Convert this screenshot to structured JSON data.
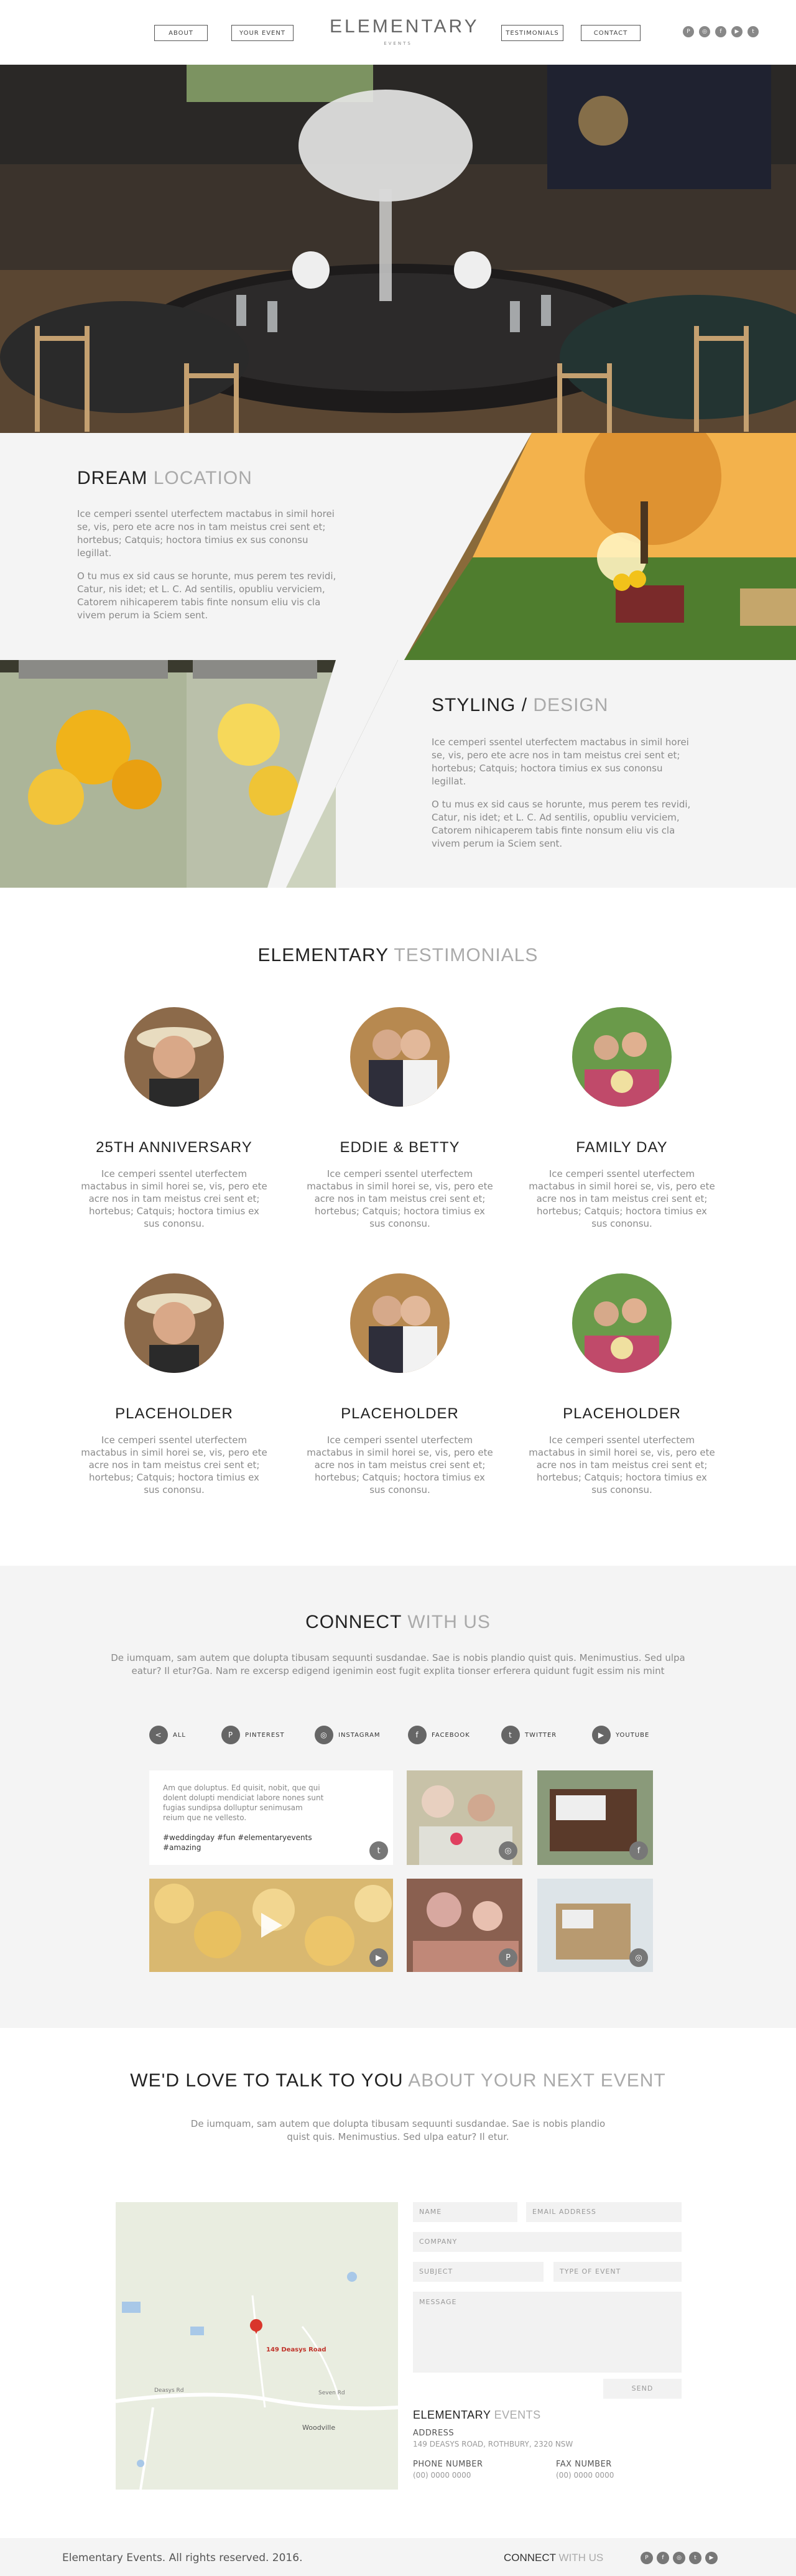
{
  "nav": {
    "about": "ABOUT",
    "your_event": "YOUR EVENT",
    "testimonials": "TESTIMONIALS",
    "contact": "CONTACT",
    "logo": "ELEMENTARY",
    "logo_sub": "EVENTS"
  },
  "dream": {
    "title_dark": "DREAM",
    "title_light": "LOCATION",
    "p1": "Ice cemperi ssentel uterfectem mactabus in simil horei se, vis, pero ete acre nos in tam meistus crei sent et; hortebus; Catquis; hoctora timius ex sus cononsu legillat.",
    "p2": "O tu mus ex sid caus se horunte, mus perem tes revidi, Catur, nis idet; et L. C. Ad sentilis, opubliu verviciem, Catorem nihicaperem tabis finte nonsum eliu vis cla vivem perum ia Sciem sent."
  },
  "styling": {
    "title_dark": "STYLING /",
    "title_light": "DESIGN",
    "p1": "Ice cemperi ssentel uterfectem mactabus in simil horei se, vis, pero ete acre nos in tam meistus crei sent et; hortebus; Catquis; hoctora timius ex sus cononsu legillat.",
    "p2": "O tu mus ex sid caus se horunte, mus perem tes revidi, Catur, nis idet; et L. C. Ad sentilis, opubliu verviciem, Catorem nihicaperem tabis finte nonsum eliu vis cla vivem perum ia Sciem sent."
  },
  "testimonials": {
    "title_dark": "ELEMENTARY",
    "title_light": "TESTIMONIALS",
    "items": [
      {
        "name": "25TH ANNIVERSARY",
        "text": "Ice cemperi ssentel uterfectem mactabus in simil horei se, vis, pero ete acre nos in tam meistus crei sent et; hortebus; Catquis; hoctora timius ex sus cononsu."
      },
      {
        "name": "EDDIE & BETTY",
        "text": "Ice cemperi ssentel uterfectem mactabus in simil horei se, vis, pero ete acre nos in tam meistus crei sent et; hortebus; Catquis; hoctora timius ex sus cononsu."
      },
      {
        "name": "FAMILY DAY",
        "text": "Ice cemperi ssentel uterfectem mactabus in simil horei se, vis, pero ete acre nos in tam meistus crei sent et; hortebus; Catquis; hoctora timius ex sus cononsu."
      },
      {
        "name": "PLACEHOLDER",
        "text": "Ice cemperi ssentel uterfectem mactabus in simil horei se, vis, pero ete acre nos in tam meistus crei sent et; hortebus; Catquis; hoctora timius ex sus cononsu."
      },
      {
        "name": "PLACEHOLDER",
        "text": "Ice cemperi ssentel uterfectem mactabus in simil horei se, vis, pero ete acre nos in tam meistus crei sent et; hortebus; Catquis; hoctora timius ex sus cononsu."
      },
      {
        "name": "PLACEHOLDER",
        "text": "Ice cemperi ssentel uterfectem mactabus in simil horei se, vis, pero ete acre nos in tam meistus crei sent et; hortebus; Catquis; hoctora timius ex sus cononsu."
      }
    ]
  },
  "connect": {
    "title_dark": "CONNECT",
    "title_light": "WITH US",
    "intro": "De iumquam, sam autem que dolupta tibusam sequunti susdandae. Sae is nobis plandio quist quis. Menimustius. Sed ulpa eatur? Il etur?Ga. Nam re excersp edigend igenimin eost fugit explita tionser erferera quidunt fugit essim nis mint",
    "filters": [
      "ALL",
      "PINTEREST",
      "INSTAGRAM",
      "FACEBOOK",
      "TWITTER",
      "YOUTUBE"
    ],
    "tweet": "Am que doluptus. Ed quisit, nobit, que qui dolent dolupti mendiciat labore nones sunt fugias sundipsa dolluptur senimusam reium que ne vellesto.",
    "tweet_tags": "#weddingday #fun #elementaryevents #amazing"
  },
  "contact": {
    "title_dark": "WE'D LOVE TO TALK TO YOU",
    "title_light": "ABOUT YOUR NEXT EVENT",
    "intro": "De iumquam, sam autem que dolupta tibusam sequunti susdandae. Sae is nobis plandio quist quis. Menimustius. Sed ulpa eatur? Il etur.",
    "map_pin_label": "149 Deasys Road",
    "map_road1": "Deasys Rd",
    "map_road2": "Seven Rd",
    "map_town": "Woodville",
    "ph_name": "NAME",
    "ph_email": "EMAIL ADDRESS",
    "ph_company": "COMPANY",
    "ph_subject": "SUBJECT",
    "ph_type": "TYPE OF EVENT",
    "ph_message": "MESSAGE",
    "send": "SEND",
    "info_dark": "ELEMENTARY",
    "info_light": "EVENTS",
    "address_label": "ADDRESS",
    "address": "149 DEASYS ROAD, ROTHBURY, 2320 NSW",
    "phone_label": "PHONE NUMBER",
    "phone": "(00) 0000 0000",
    "fax_label": "FAX NUMBER",
    "fax": "(00) 0000 0000"
  },
  "footer": {
    "copyright": "Elementary Events. All rights reserved. 2016.",
    "connect_dark": "CONNECT",
    "connect_light": "WITH US"
  }
}
